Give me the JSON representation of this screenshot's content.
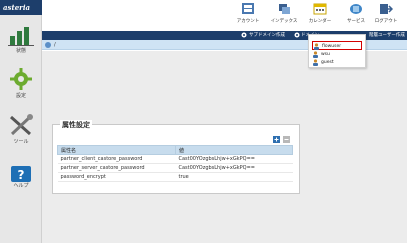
{
  "app": {
    "logo_text": "asteria"
  },
  "sidebar": {
    "items": [
      {
        "label": "状態",
        "icon": "bar-chart-icon"
      },
      {
        "label": "設定",
        "icon": "gear-icon"
      },
      {
        "label": "ツール",
        "icon": "wrench-screwdriver-icon"
      },
      {
        "label": "ヘルプ",
        "icon": "help-icon"
      }
    ]
  },
  "topbar": {
    "buttons": [
      {
        "label": "アカウント",
        "icon": "account-icon"
      },
      {
        "label": "インデックス",
        "icon": "index-icon"
      },
      {
        "label": "カレンダー",
        "icon": "calendar-icon"
      },
      {
        "label": "サービス",
        "icon": "service-icon"
      },
      {
        "label": "ログアウト",
        "icon": "logout-icon"
      }
    ]
  },
  "subbar": {
    "items": [
      {
        "label": "サブドメイン作成"
      },
      {
        "label": "ドメイン"
      },
      {
        "label": "階層ユーザー作成"
      }
    ]
  },
  "path": {
    "text": "/"
  },
  "dropdown": {
    "items": [
      {
        "label": "flowuser",
        "selected": true
      },
      {
        "label": "wsu",
        "selected": false
      },
      {
        "label": "guest",
        "selected": false
      }
    ]
  },
  "panel": {
    "title": "属性設定",
    "columns": [
      "属性名",
      "値"
    ],
    "rows": [
      {
        "name": "partner_client_castore_password",
        "value": "Cast00YOzgbsLhjw+xGkPQ=="
      },
      {
        "name": "partner_server_castore_password",
        "value": "Cast00YOzgbsLhjw+xGkPQ=="
      },
      {
        "name": "password_encrypt",
        "value": "true"
      }
    ]
  },
  "colors": {
    "accent": "#1d3e6b",
    "highlight": "#d40000",
    "header_bg": "#c7dced"
  }
}
